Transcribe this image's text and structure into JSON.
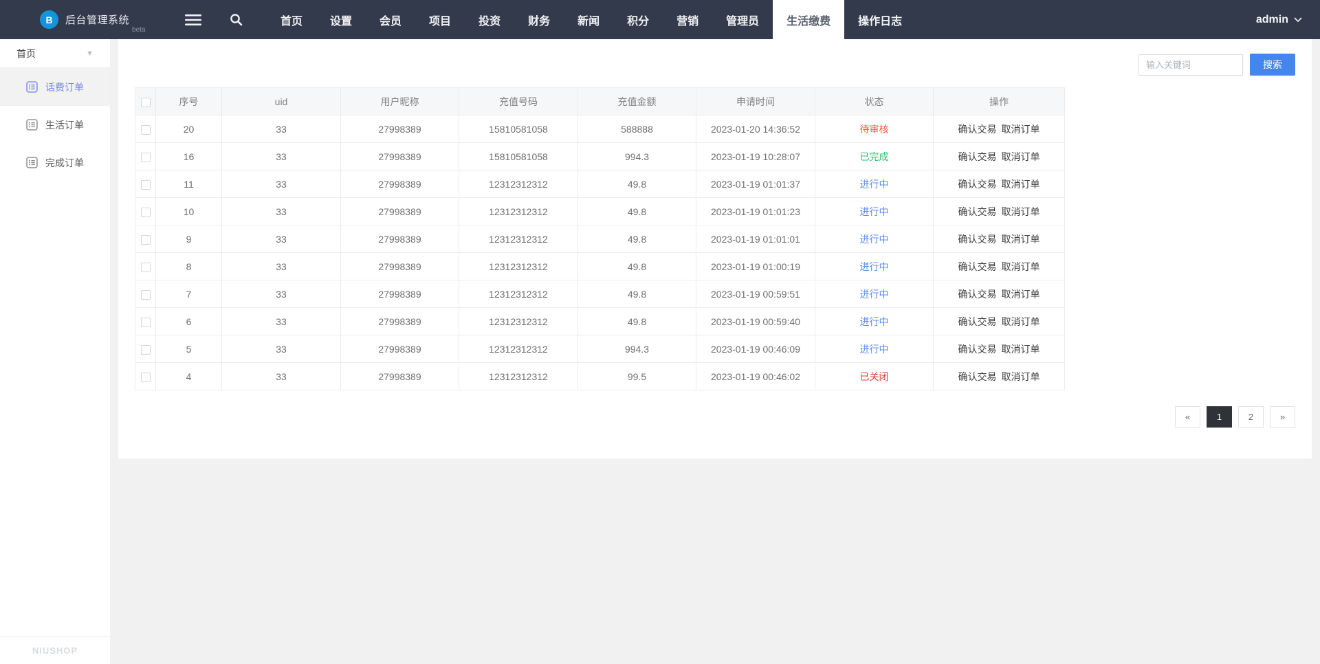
{
  "navbar": {
    "brand": {
      "title": "后台管理系统",
      "badge": "beta",
      "logo_letter": "B"
    },
    "icons": [
      "hamburger-icon",
      "search-icon"
    ],
    "items": [
      {
        "label": "首页"
      },
      {
        "label": "设置"
      },
      {
        "label": "会员"
      },
      {
        "label": "项目"
      },
      {
        "label": "投资"
      },
      {
        "label": "财务"
      },
      {
        "label": "新闻"
      },
      {
        "label": "积分"
      },
      {
        "label": "营销"
      },
      {
        "label": "管理员"
      },
      {
        "label": "生活缴费"
      },
      {
        "label": "操作日志"
      }
    ],
    "active": "生活缴费",
    "user": "admin"
  },
  "sidebar": {
    "group": "首页",
    "items": [
      {
        "label": "话费订单",
        "active": true
      },
      {
        "label": "生活订单",
        "active": false
      },
      {
        "label": "完成订单",
        "active": false
      }
    ],
    "footer": "NIUSHOP"
  },
  "search": {
    "placeholder": "输入关键词",
    "button": "搜索"
  },
  "table": {
    "columns": [
      "序号",
      "uid",
      "用户昵称",
      "充值号码",
      "充值金额",
      "申请时间",
      "状态",
      "操作"
    ],
    "actions": [
      "确认交易",
      "取消订单"
    ],
    "rows": [
      {
        "seq": "20",
        "uid": "33",
        "nickname": "27998389",
        "number": "15810581058",
        "amount": "588888",
        "time": "2023-01-20 14:36:52",
        "status": "待审核",
        "status_type": "pending"
      },
      {
        "seq": "16",
        "uid": "33",
        "nickname": "27998389",
        "number": "15810581058",
        "amount": "994.3",
        "time": "2023-01-19 10:28:07",
        "status": "已完成",
        "status_type": "done"
      },
      {
        "seq": "11",
        "uid": "33",
        "nickname": "27998389",
        "number": "12312312312",
        "amount": "49.8",
        "time": "2023-01-19 01:01:37",
        "status": "进行中",
        "status_type": "progress"
      },
      {
        "seq": "10",
        "uid": "33",
        "nickname": "27998389",
        "number": "12312312312",
        "amount": "49.8",
        "time": "2023-01-19 01:01:23",
        "status": "进行中",
        "status_type": "progress"
      },
      {
        "seq": "9",
        "uid": "33",
        "nickname": "27998389",
        "number": "12312312312",
        "amount": "49.8",
        "time": "2023-01-19 01:01:01",
        "status": "进行中",
        "status_type": "progress"
      },
      {
        "seq": "8",
        "uid": "33",
        "nickname": "27998389",
        "number": "12312312312",
        "amount": "49.8",
        "time": "2023-01-19 01:00:19",
        "status": "进行中",
        "status_type": "progress"
      },
      {
        "seq": "7",
        "uid": "33",
        "nickname": "27998389",
        "number": "12312312312",
        "amount": "49.8",
        "time": "2023-01-19 00:59:51",
        "status": "进行中",
        "status_type": "progress"
      },
      {
        "seq": "6",
        "uid": "33",
        "nickname": "27998389",
        "number": "12312312312",
        "amount": "49.8",
        "time": "2023-01-19 00:59:40",
        "status": "进行中",
        "status_type": "progress"
      },
      {
        "seq": "5",
        "uid": "33",
        "nickname": "27998389",
        "number": "12312312312",
        "amount": "994.3",
        "time": "2023-01-19 00:46:09",
        "status": "进行中",
        "status_type": "progress"
      },
      {
        "seq": "4",
        "uid": "33",
        "nickname": "27998389",
        "number": "12312312312",
        "amount": "99.5",
        "time": "2023-01-19 00:46:02",
        "status": "已关闭",
        "status_type": "closed"
      }
    ]
  },
  "pagination": {
    "prev": "«",
    "pages": [
      {
        "label": "1",
        "active": true
      },
      {
        "label": "2",
        "active": false
      }
    ],
    "next": "»"
  },
  "colors": {
    "navbar_bg": "#333a4b",
    "primary_blue": "#4486ee",
    "sidebar_active": "#7886f4",
    "time_orange": "#fbb03b",
    "status_pending": "#f25b40",
    "status_done": "#2ac06d",
    "status_progress": "#5a8dee",
    "status_closed": "#e13c39",
    "pager_active_bg": "#2f3338",
    "logo_blue": "#1296db"
  }
}
